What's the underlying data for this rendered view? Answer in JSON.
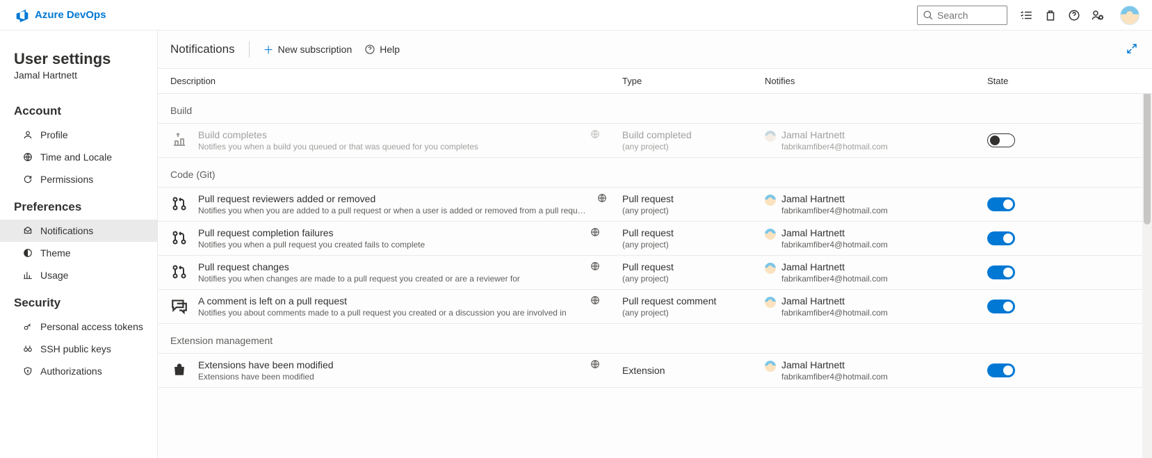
{
  "brand": {
    "name": "Azure DevOps"
  },
  "search": {
    "placeholder": "Search"
  },
  "sidebar": {
    "title": "User settings",
    "subtitle": "Jamal Hartnett",
    "sections": [
      {
        "heading": "Account",
        "items": [
          {
            "label": "Profile"
          },
          {
            "label": "Time and Locale"
          },
          {
            "label": "Permissions"
          }
        ]
      },
      {
        "heading": "Preferences",
        "items": [
          {
            "label": "Notifications"
          },
          {
            "label": "Theme"
          },
          {
            "label": "Usage"
          }
        ]
      },
      {
        "heading": "Security",
        "items": [
          {
            "label": "Personal access tokens"
          },
          {
            "label": "SSH public keys"
          },
          {
            "label": "Authorizations"
          }
        ]
      }
    ]
  },
  "commands": {
    "page_title": "Notifications",
    "new_subscription": "New subscription",
    "help": "Help"
  },
  "columns": {
    "description": "Description",
    "type": "Type",
    "notifies": "Notifies",
    "state": "State"
  },
  "groups": [
    {
      "name": "Build",
      "rows": [
        {
          "title": "Build completes",
          "subtitle": "Notifies you when a build you queued or that was queued for you completes",
          "type_main": "Build completed",
          "type_sub": "(any project)",
          "notifies_name": "Jamal Hartnett",
          "notifies_email": "fabrikamfiber4@hotmail.com",
          "state": "off",
          "icon": "build"
        }
      ]
    },
    {
      "name": "Code (Git)",
      "rows": [
        {
          "title": "Pull request reviewers added or removed",
          "subtitle": "Notifies you when you are added to a pull request or when a user is added or removed from a pull request y",
          "type_main": "Pull request",
          "type_sub": "(any project)",
          "notifies_name": "Jamal Hartnett",
          "notifies_email": "fabrikamfiber4@hotmail.com",
          "state": "on",
          "icon": "pr"
        },
        {
          "title": "Pull request completion failures",
          "subtitle": "Notifies you when a pull request you created fails to complete",
          "type_main": "Pull request",
          "type_sub": "(any project)",
          "notifies_name": "Jamal Hartnett",
          "notifies_email": "fabrikamfiber4@hotmail.com",
          "state": "on",
          "icon": "pr"
        },
        {
          "title": "Pull request changes",
          "subtitle": "Notifies you when changes are made to a pull request you created or are a reviewer for",
          "type_main": "Pull request",
          "type_sub": "(any project)",
          "notifies_name": "Jamal Hartnett",
          "notifies_email": "fabrikamfiber4@hotmail.com",
          "state": "on",
          "icon": "pr"
        },
        {
          "title": "A comment is left on a pull request",
          "subtitle": "Notifies you about comments made to a pull request you created or a discussion you are involved in",
          "type_main": "Pull request comment",
          "type_sub": "(any project)",
          "notifies_name": "Jamal Hartnett",
          "notifies_email": "fabrikamfiber4@hotmail.com",
          "state": "on",
          "icon": "comment"
        }
      ]
    },
    {
      "name": "Extension management",
      "rows": [
        {
          "title": "Extensions have been modified",
          "subtitle": "Extensions have been modified",
          "type_main": "Extension",
          "type_sub": "",
          "notifies_name": "Jamal Hartnett",
          "notifies_email": "fabrikamfiber4@hotmail.com",
          "state": "on",
          "icon": "bag"
        }
      ]
    }
  ]
}
